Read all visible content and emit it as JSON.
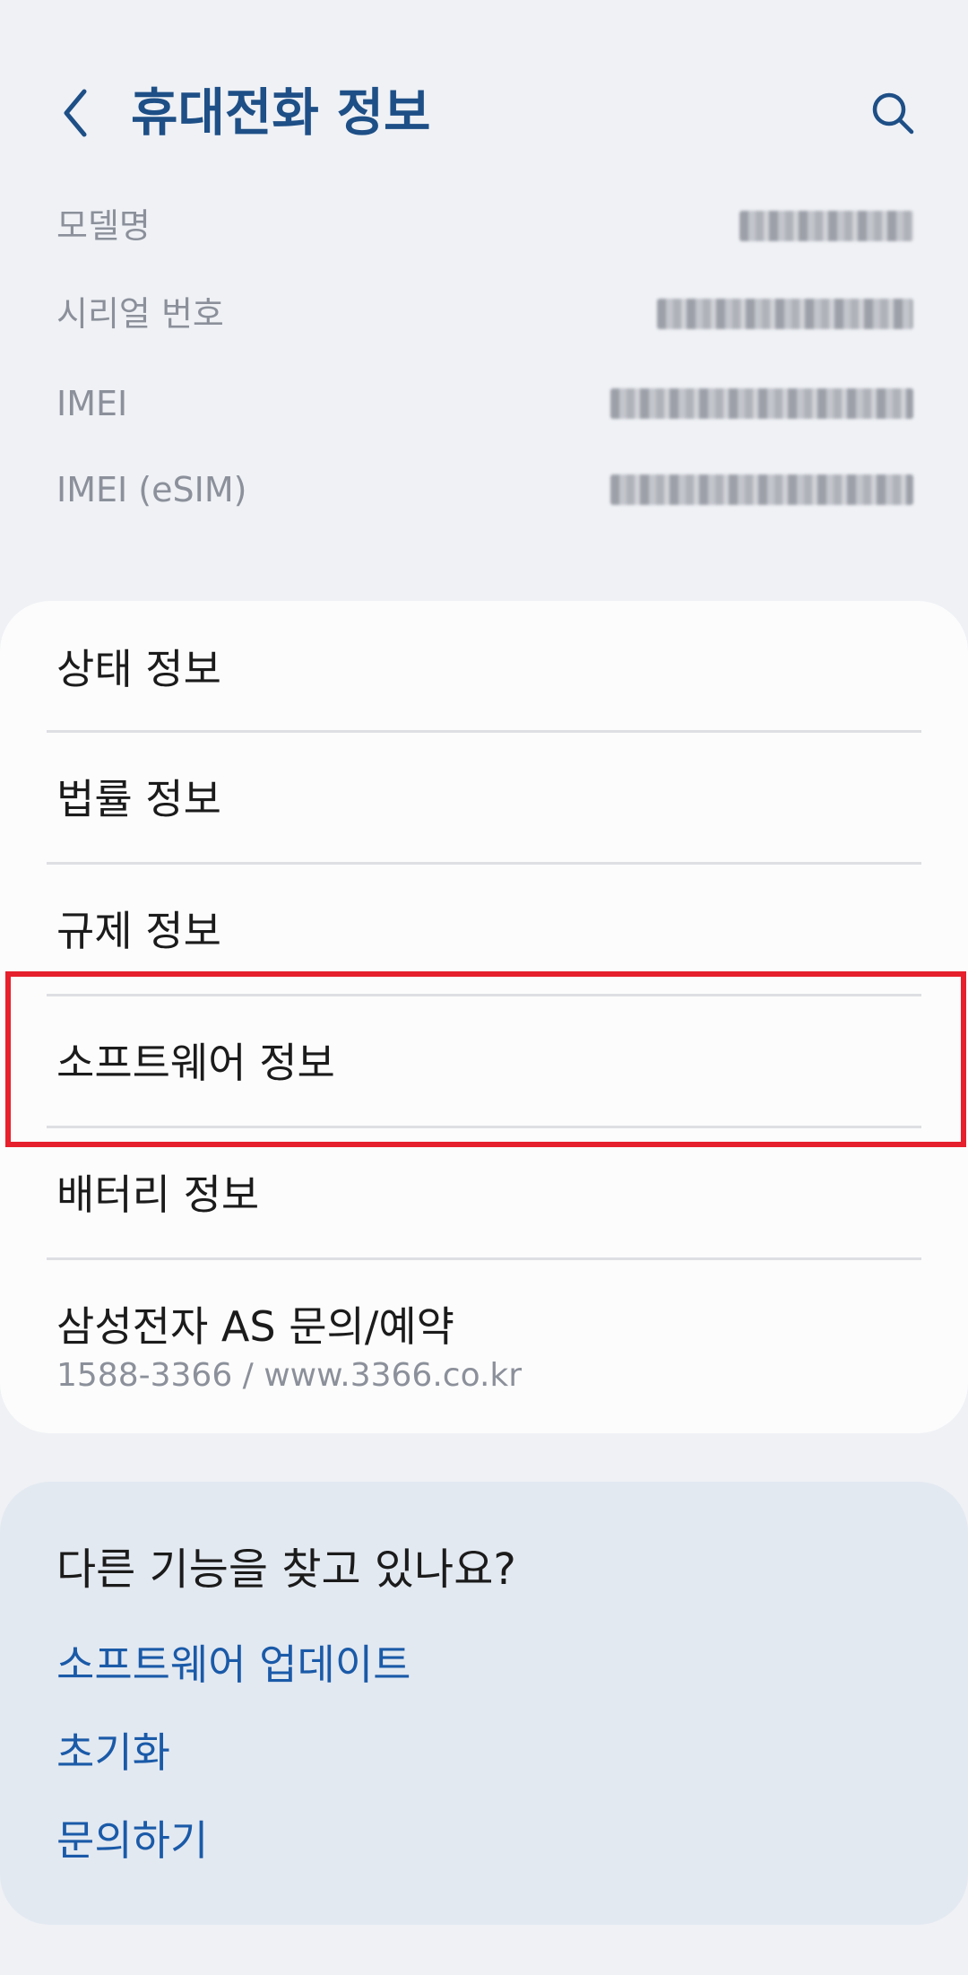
{
  "header": {
    "title": "휴대전화 정보",
    "back_icon": "chevron-left-icon",
    "search_icon": "search-icon"
  },
  "device_info": [
    {
      "label": "모델명"
    },
    {
      "label": "시리얼 번호"
    },
    {
      "label": "IMEI"
    },
    {
      "label": "IMEI (eSIM)"
    }
  ],
  "menu": {
    "items": [
      {
        "label": "상태 정보"
      },
      {
        "label": "법률 정보"
      },
      {
        "label": "규제 정보"
      },
      {
        "label": "소프트웨어 정보"
      },
      {
        "label": "배터리 정보"
      },
      {
        "label": "삼성전자 AS 문의/예약",
        "sub": "1588-3366 / www.3366.co.kr"
      }
    ]
  },
  "suggestions": {
    "title": "다른 기능을 찾고 있나요?",
    "links": [
      "소프트웨어 업데이트",
      "초기화",
      "문의하기"
    ]
  },
  "colors": {
    "title": "#1e4f86",
    "link": "#1a5aa8",
    "highlight": "#e6202c",
    "background": "#eff1f5"
  }
}
